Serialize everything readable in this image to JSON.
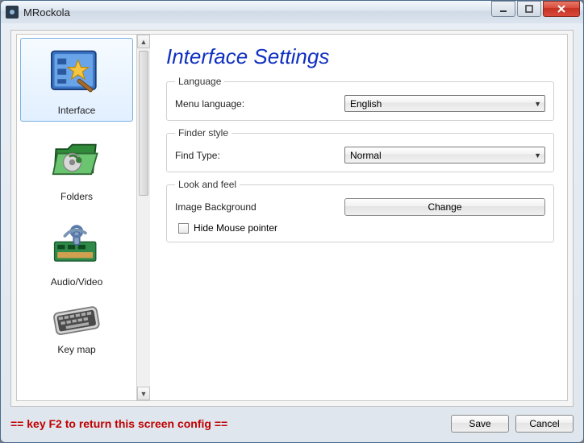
{
  "window": {
    "title": "MRockola"
  },
  "sidebar": {
    "items": [
      {
        "label": "Interface"
      },
      {
        "label": "Folders"
      },
      {
        "label": "Audio/Video"
      },
      {
        "label": "Key map"
      }
    ]
  },
  "page": {
    "title": "Interface Settings"
  },
  "groups": {
    "language": {
      "legend": "Language",
      "menu_label": "Menu language:",
      "menu_value": "English"
    },
    "finder": {
      "legend": "Finder style",
      "find_label": "Find Type:",
      "find_value": "Normal"
    },
    "look": {
      "legend": "Look and feel",
      "image_bg_label": "Image Background",
      "change_label": "Change",
      "hide_mouse_label": "Hide Mouse pointer"
    }
  },
  "footer": {
    "hint": "== key F2 to return this screen config ==",
    "save": "Save",
    "cancel": "Cancel"
  }
}
